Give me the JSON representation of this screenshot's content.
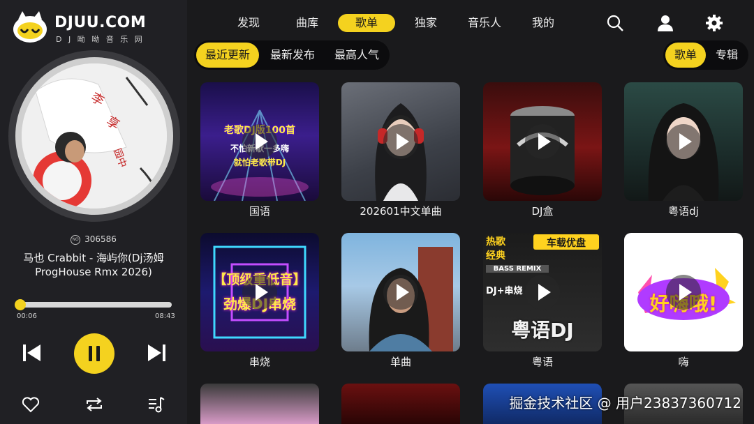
{
  "brand": {
    "title": "DJUU.COM",
    "subtitle": "D J 呦 呦 音 乐 网"
  },
  "player": {
    "play_count": "306586",
    "song_title": "马也 Crabbit - 海屿你(Dj汤姆ProgHouse Rmx 2026)",
    "progress": 0.012,
    "current_time": "00:06",
    "duration": "08:43",
    "icons": {
      "prev": "skip-previous-icon",
      "pause": "pause-icon",
      "next": "skip-next-icon",
      "like": "heart-icon",
      "loop": "repeat-icon",
      "playlist": "playlist-icon"
    },
    "accent_color": "#f4d21f"
  },
  "nav": {
    "items": [
      {
        "label": "发现"
      },
      {
        "label": "曲库"
      },
      {
        "label": "歌单",
        "active": true
      },
      {
        "label": "独家"
      },
      {
        "label": "音乐人"
      },
      {
        "label": "我的"
      }
    ],
    "icons": [
      "search-icon",
      "user-icon",
      "gear-icon"
    ]
  },
  "filters": {
    "sort": [
      {
        "label": "最近更新",
        "active": true
      },
      {
        "label": "最新发布"
      },
      {
        "label": "最高人气"
      }
    ],
    "type": [
      {
        "label": "歌单",
        "active": true
      },
      {
        "label": "专辑"
      }
    ]
  },
  "playlists": [
    {
      "label": "国语",
      "overlay": [
        "老歌DJ版100首",
        "不怕新歌一多嗨",
        "就怕老歌带DJ"
      ]
    },
    {
      "label": "202601中文单曲"
    },
    {
      "label": "DJ盒"
    },
    {
      "label": "粤语dj"
    },
    {
      "label": "串烧",
      "overlay": [
        "【顶级重低音】",
        "劲爆DJ串烧"
      ]
    },
    {
      "label": "单曲"
    },
    {
      "label": "粤语",
      "overlay": [
        "热歌",
        "经典",
        "车载优盘",
        "BASS REMIX",
        "DJ+串烧",
        "粤语DJ"
      ]
    },
    {
      "label": "嗨",
      "overlay": [
        "好嗨哦!"
      ]
    }
  ],
  "watermark": "掘金技术社区 @ 用户2383736071​2"
}
